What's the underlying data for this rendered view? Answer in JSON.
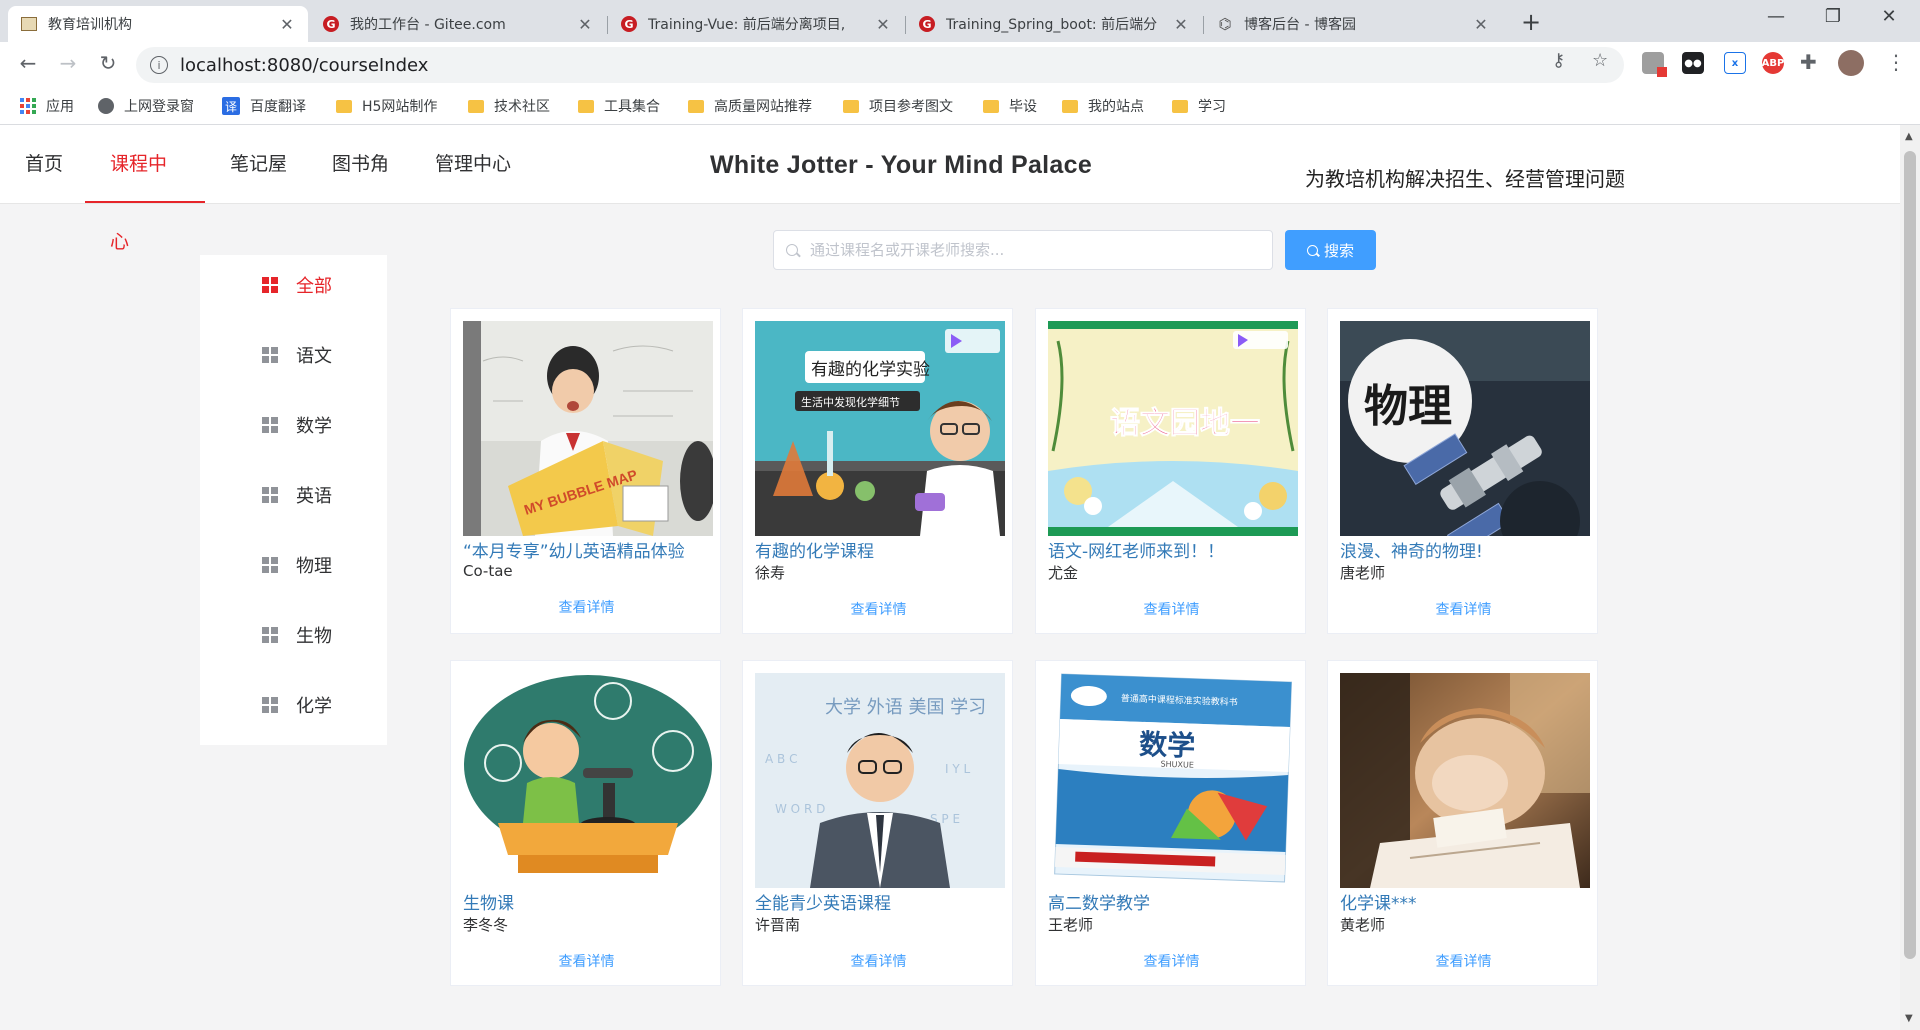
{
  "browser": {
    "tabs": [
      {
        "title": "教育培训机构",
        "active": true,
        "favicon": "site-icon"
      },
      {
        "title": "我的工作台 - Gitee.com",
        "active": false,
        "favicon": "gitee-icon"
      },
      {
        "title": "Training-Vue: 前后端分离项目,",
        "active": false,
        "favicon": "gitee-icon"
      },
      {
        "title": "Training_Spring_boot: 前后端分",
        "active": false,
        "favicon": "gitee-icon"
      },
      {
        "title": "博客后台 - 博客园",
        "active": false,
        "favicon": "cnblogs-icon"
      }
    ],
    "url": "localhost:8080/courseIndex",
    "bookmarks": [
      {
        "label": "应用",
        "icon": "apps-icon"
      },
      {
        "label": "上网登录窗",
        "icon": "globe-icon"
      },
      {
        "label": "百度翻译",
        "icon": "translate-icon"
      },
      {
        "label": "H5网站制作",
        "icon": "folder-icon"
      },
      {
        "label": "技术社区",
        "icon": "folder-icon"
      },
      {
        "label": "工具集合",
        "icon": "folder-icon"
      },
      {
        "label": "高质量网站推荐",
        "icon": "folder-icon"
      },
      {
        "label": "项目参考图文",
        "icon": "folder-icon"
      },
      {
        "label": "毕设",
        "icon": "folder-icon"
      },
      {
        "label": "我的站点",
        "icon": "folder-icon"
      },
      {
        "label": "学习",
        "icon": "folder-icon"
      }
    ],
    "translate_glyph": "译",
    "abp_label": "ABP"
  },
  "nav": {
    "items": [
      "首页",
      "课程中心",
      "笔记屋",
      "图书角",
      "管理中心"
    ],
    "active_index": 1,
    "brand": "White Jotter - Your Mind Palace",
    "slogan": "为教培机构解决招生、经营管理问题"
  },
  "categories": {
    "items": [
      "全部",
      "语文",
      "数学",
      "英语",
      "物理",
      "生物",
      "化学"
    ],
    "active_index": 0
  },
  "search": {
    "placeholder": "通过课程名或开课老师搜索...",
    "value": "",
    "button": "搜索"
  },
  "courses": [
    {
      "title": "“本月专享”幼儿英语精品体验",
      "teacher": "Co-tae",
      "more": "查看详情"
    },
    {
      "title": "有趣的化学课程",
      "teacher": "徐寿",
      "more": "查看详情"
    },
    {
      "title": "语文-网红老师来到！！",
      "teacher": "尤金",
      "more": "查看详情"
    },
    {
      "title": "浪漫、神奇的物理!",
      "teacher": "唐老师",
      "more": "查看详情"
    },
    {
      "title": "生物课",
      "teacher": "李冬冬",
      "more": "查看详情"
    },
    {
      "title": "全能青少英语课程",
      "teacher": "许晋南",
      "more": "查看详情"
    },
    {
      "title": "高二数学教学",
      "teacher": "王老师",
      "more": "查看详情"
    },
    {
      "title": "化学课***",
      "teacher": "黄老师",
      "more": "查看详情"
    }
  ],
  "thumb_text": {
    "english": "MY BUBBLE MAP",
    "chemistry_title": "有趣的化学实验",
    "chemistry_sub": "生活中发现化学细节",
    "chinese": "语文园地一",
    "physics": "物理",
    "math": "数学",
    "math_sub": "SHUXUE",
    "english2_words": "大学 外语 美国 学习",
    "math_series": "普通高中课程标准实验教科书"
  },
  "colors": {
    "accent_red": "#e6252a",
    "link_blue": "#337ab7",
    "primary_blue": "#409eff"
  }
}
